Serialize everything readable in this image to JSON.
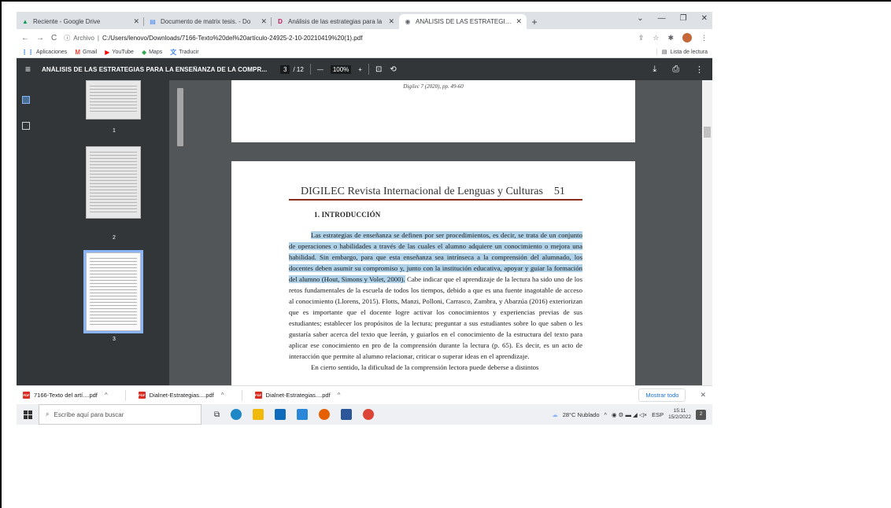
{
  "browser": {
    "tabs": [
      {
        "label": "Reciente - Google Drive",
        "icon": "google-drive-icon",
        "icon_color": "#0f9d58"
      },
      {
        "label": "Documento de matrix tesis. - Do",
        "icon": "google-docs-icon",
        "icon_color": "#4285f4"
      },
      {
        "label": "Análisis de las estrategias para la",
        "icon": "dialnet-icon",
        "icon_color": "#c2185b"
      },
      {
        "label": "ANÁLISIS DE LAS ESTRATEGIAS |",
        "icon": "globe-icon",
        "icon_color": "#5f6368"
      }
    ],
    "new_tab": "+",
    "url_prefix": "Archivo",
    "url": "C:/Users/lenovo/Downloads/7166-Texto%20del%20artículo-24925-2-10-20210419%20(1).pdf",
    "bookmarks": [
      {
        "label": "Aplicaciones",
        "icon": "apps-grid-icon",
        "color": "#1a73e8"
      },
      {
        "label": "Gmail",
        "icon": "gmail-icon",
        "color": "#ea4335"
      },
      {
        "label": "YouTube",
        "icon": "youtube-icon",
        "color": "#ff0000"
      },
      {
        "label": "Maps",
        "icon": "maps-icon",
        "color": "#34a853"
      },
      {
        "label": "Traducir",
        "icon": "translate-icon",
        "color": "#4285f4"
      }
    ],
    "reading_list": "Lista de lectura"
  },
  "pdf": {
    "title": "ANÁLISIS DE LAS ESTRATEGIAS PARA LA ENSEÑANZA DE LA COMPR...",
    "page_current": "3",
    "page_total": "/ 12",
    "zoom": "100%",
    "thumb_labels": [
      "1",
      "2",
      "3"
    ],
    "prev_page_footer": "Digilec 7 (2020), pp. 49-60",
    "journal_header": "DIGILEC Revista Internacional de Lenguas y Culturas",
    "page_number": "51",
    "section": "1.  INTRODUCCIÓN",
    "highlighted_text": "Las estrategias de enseñanza se definen por ser procedimientos, es decir, se trata de un conjunto de operaciones o habilidades a través de las cuales el alumno adquiere un conocimiento o mejora una habilidad. Sin embargo, para que esta enseñanza sea intrínseca a la comprensión del alumnado, los docentes deben asumir su compromiso y, junto con la institución educativa, apoyar y guiar la formación del alumno (Hout, Simons y Volet, 2000).",
    "body_text": " Cabe indicar que el aprendizaje de la lectura ha sido uno de los retos fundamentales de la escuela de todos los tiempos, debido a que es una fuente inagotable de acceso al conocimiento (Llorens, 2015). Flotts, Manzi, Polloni, Carrasco, Zambra, y Abarzúa (2016) exteriorizan que es importante que el docente logre activar los conocimientos y experiencias previas de sus estudiantes; establecer los propósitos de la lectura; preguntar a sus estudiantes sobre lo que saben o les gustaría saber acerca del texto que leerán, y guiarlos en el conocimiento de la estructura del texto para aplicar ese conocimiento en pro de la comprensión durante la lectura (p. 65). Es decir, es un acto de interacción que permite al alumno relacionar, criticar o superar ideas en el aprendizaje.",
    "cut_text": "En cierto sentido, la dificultad de la comprensión lectora puede deberse a distintos"
  },
  "downloads": {
    "items": [
      "7166-Texto del artí....pdf",
      "Dialnet-Estrategias....pdf",
      "Dialnet-Estrategias....pdf"
    ],
    "show_all": "Mostrar todo"
  },
  "taskbar": {
    "search_placeholder": "Escribe aquí para buscar",
    "weather": "28°C  Nublado",
    "lang": "ESP",
    "time": "15:11",
    "date": "15/2/2022",
    "notifications": "2"
  }
}
